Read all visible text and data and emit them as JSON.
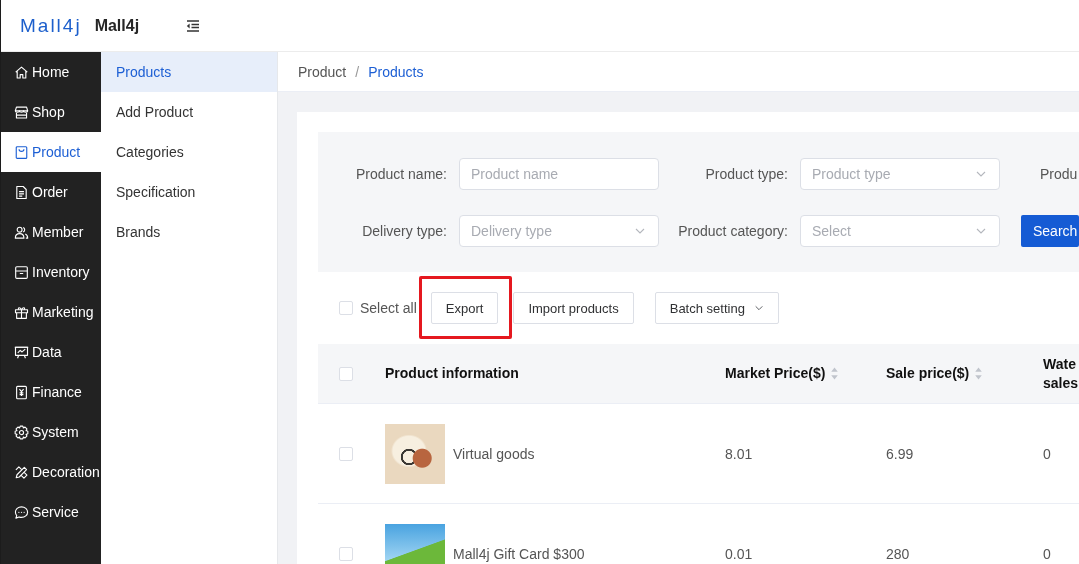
{
  "header": {
    "logo": "Mall4j",
    "title": "Mall4j"
  },
  "sidebar": {
    "items": [
      {
        "label": "Home",
        "selected": false
      },
      {
        "label": "Shop",
        "selected": false
      },
      {
        "label": "Product",
        "selected": true
      },
      {
        "label": "Order",
        "selected": false
      },
      {
        "label": "Member",
        "selected": false
      },
      {
        "label": "Inventory",
        "selected": false
      },
      {
        "label": "Marketing",
        "selected": false
      },
      {
        "label": "Data",
        "selected": false
      },
      {
        "label": "Finance",
        "selected": false
      },
      {
        "label": "System",
        "selected": false
      },
      {
        "label": "Decoration",
        "selected": false
      },
      {
        "label": "Service",
        "selected": false
      }
    ]
  },
  "submenu": {
    "items": [
      {
        "label": "Products",
        "selected": true
      },
      {
        "label": "Add Product",
        "selected": false
      },
      {
        "label": "Categories",
        "selected": false
      },
      {
        "label": "Specification",
        "selected": false
      },
      {
        "label": "Brands",
        "selected": false
      }
    ]
  },
  "breadcrumb": {
    "separator": "/",
    "items": [
      {
        "label": "Product",
        "current": false
      },
      {
        "label": "Products",
        "current": true
      }
    ]
  },
  "filters": {
    "rows": [
      [
        {
          "kind": "input",
          "label": "Product name:",
          "placeholder": "Product name"
        },
        {
          "kind": "select",
          "label": "Product type:",
          "placeholder": "Product type"
        },
        {
          "kind": "label",
          "label": "Produ"
        }
      ],
      [
        {
          "kind": "select",
          "label": "Delivery type:",
          "placeholder": "Delivery type"
        },
        {
          "kind": "select",
          "label": "Product category:",
          "placeholder": "Select"
        },
        {
          "kind": "button",
          "label": "Search"
        }
      ]
    ]
  },
  "toolbar": {
    "select_all": {
      "label": "Select all",
      "checked": false
    },
    "buttons": [
      {
        "kind": "plain",
        "label": "Export",
        "highlighted": true
      },
      {
        "kind": "plain",
        "label": "Import products",
        "highlighted": false
      },
      {
        "kind": "dropdown",
        "label": "Batch setting",
        "highlighted": false
      }
    ]
  },
  "table": {
    "all_checked": false,
    "columns": [
      {
        "label": "Product information",
        "sortable": false
      },
      {
        "label": "Market Price($)",
        "sortable": true
      },
      {
        "label": "Sale price($)",
        "sortable": true
      },
      {
        "label": "Wate sales",
        "sortable": false
      }
    ],
    "rows": [
      {
        "selected": false,
        "product": "Virtual goods",
        "values": [
          "8.01",
          "6.99",
          "0"
        ]
      },
      {
        "selected": false,
        "product": "Mall4j Gift Card $300",
        "values": [
          "0.01",
          "280",
          "0"
        ]
      }
    ]
  }
}
